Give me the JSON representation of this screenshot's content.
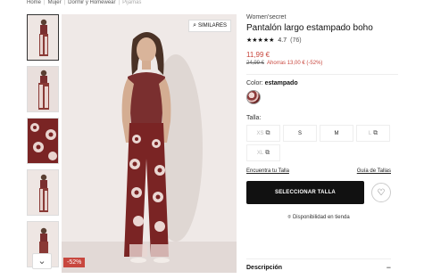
{
  "breadcrumb": {
    "items": [
      "Home",
      "Mujer",
      "Dormir y Homewear"
    ],
    "current": "Pijamas"
  },
  "gallery": {
    "similar_label": "SIMILARES",
    "discount_badge": "-52%",
    "thumbnail_count": 5,
    "scroll_icon": "chevron-down-icon"
  },
  "product": {
    "brand": "Women'secret",
    "title": "Pantalón largo estampado boho",
    "stars": "★★★★★",
    "rating": "4.7",
    "rating_count": "(76)",
    "price": "11,99 €",
    "old_price": "24,99 €",
    "savings": "Ahorras 13,00 € (-52%)",
    "color_label": "Color:",
    "color_value": "estampado",
    "size_label": "Talla:",
    "sizes": [
      {
        "label": "XS",
        "available": false
      },
      {
        "label": "S",
        "available": true
      },
      {
        "label": "M",
        "available": true
      },
      {
        "label": "L",
        "available": false
      },
      {
        "label": "XL",
        "available": false
      }
    ],
    "size_guide_link": "Encuentra tu Talla",
    "size_table_link": "Guía de Tallas",
    "select_button": "SELECCIONAR TALLA",
    "store_availability": "Disponibilidad en tienda",
    "description_label": "Descripción",
    "description_toggle": "−"
  },
  "colors": {
    "accent": "#c8473e",
    "button": "#111111",
    "top": "#7a2f2f",
    "pants_base": "#efe4e0",
    "pants_pattern": "#7a2424"
  }
}
